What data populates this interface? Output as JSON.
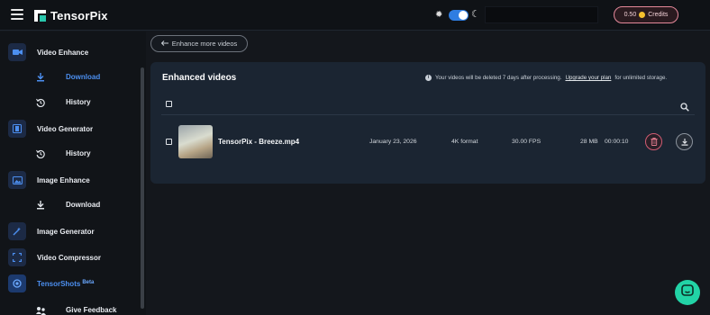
{
  "app": {
    "name": "TensorPix"
  },
  "header": {
    "credits_amount": "0.50",
    "credits_label": "Credits"
  },
  "sidebar": {
    "items": [
      {
        "label": "Video Enhance",
        "icon": "video-camera-icon"
      },
      {
        "label": "Download",
        "icon": "download-icon",
        "sub": true,
        "active": true
      },
      {
        "label": "History",
        "icon": "history-icon",
        "sub": true
      },
      {
        "label": "Video Generator",
        "icon": "film-icon"
      },
      {
        "label": "History",
        "icon": "history-icon",
        "sub": true
      },
      {
        "label": "Image Enhance",
        "icon": "image-icon"
      },
      {
        "label": "Download",
        "icon": "download-icon",
        "sub": true
      },
      {
        "label": "Image Generator",
        "icon": "magic-wand-icon"
      },
      {
        "label": "Video Compressor",
        "icon": "compress-icon"
      },
      {
        "label": "TensorShots",
        "badge": "Beta",
        "icon": "tensorshots-icon"
      },
      {
        "label": "Give Feedback",
        "icon": "feedback-icon",
        "sub": true
      }
    ]
  },
  "main": {
    "back_button_label": "Enhance more videos",
    "panel_title": "Enhanced videos",
    "notice_prefix": "Your videos will be deleted 7 days after processing.",
    "notice_link": "Upgrade your plan",
    "notice_suffix": "for unlimited storage.",
    "videos": [
      {
        "name": "TensorPix - Breeze.mp4",
        "date": "January 23, 2026",
        "format": "4K format",
        "fps": "30.00 FPS",
        "size": "28 MB",
        "duration": "00:00:10"
      }
    ]
  },
  "colors": {
    "accent_blue": "#4c8ff0",
    "credits_border": "#e4889a",
    "delete_red": "#d15c73",
    "chat_green": "#22d3a6",
    "panel_bg": "#1b2532"
  }
}
